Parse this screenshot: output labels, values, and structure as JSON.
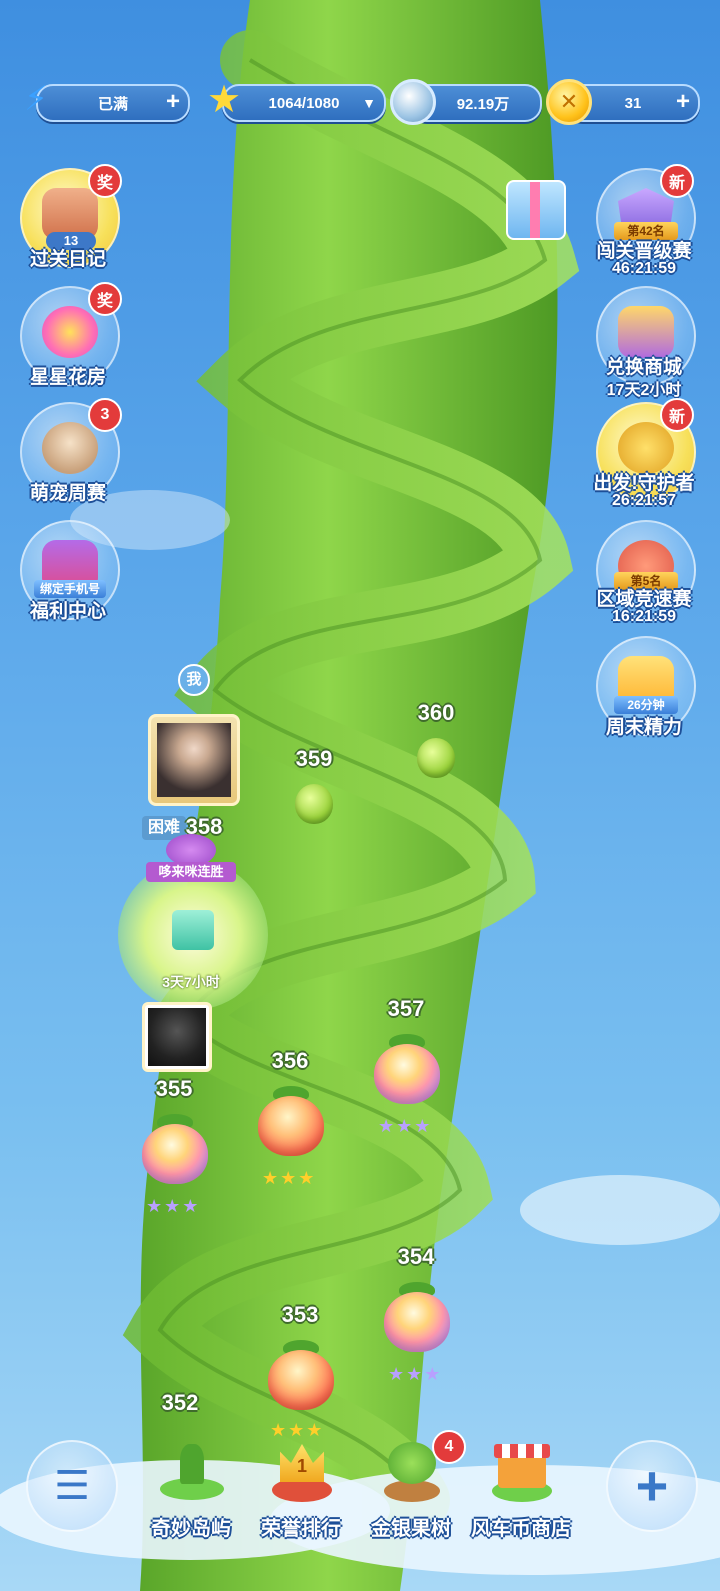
{
  "topbar": {
    "energy": {
      "value": "已满",
      "icon": "lightning-icon"
    },
    "stars": {
      "value": "1064/1080",
      "icon": "star-icon"
    },
    "silver": {
      "value": "92.19万",
      "icon": "silver-coin-icon"
    },
    "gold": {
      "value": "31",
      "icon": "gold-coin-icon"
    }
  },
  "left_menu": [
    {
      "label": "过关日记",
      "badge": "奖",
      "count": "13"
    },
    {
      "label": "星星花房",
      "badge": "奖"
    },
    {
      "label": "萌宠周赛",
      "badge": "3"
    },
    {
      "label": "福利中心",
      "tag": "绑定手机号"
    }
  ],
  "right_menu": [
    {
      "label": "闯关晋级赛",
      "badge": "新",
      "tag": "第42名",
      "timer": "46:21:59"
    },
    {
      "label": "兑换商城",
      "timer": "17天2小时"
    },
    {
      "label": "出发!守护者",
      "badge": "新",
      "timer": "26:21:57"
    },
    {
      "label": "区域竞速赛",
      "tag": "第5名",
      "timer": "16:21:59"
    },
    {
      "label": "周末精力",
      "tag": "26分钟"
    }
  ],
  "player": {
    "me_label": "我",
    "difficulty": "困难",
    "current_level": "358",
    "streak_label": "哆来咪连胜",
    "streak_timer": "3天7小时"
  },
  "levels": [
    {
      "num": "360",
      "state": "locked"
    },
    {
      "num": "359",
      "state": "locked"
    },
    {
      "num": "357",
      "stars": 3
    },
    {
      "num": "356",
      "stars": 3
    },
    {
      "num": "355",
      "stars": 3
    },
    {
      "num": "354",
      "stars": 3
    },
    {
      "num": "353",
      "stars": 3
    },
    {
      "num": "352",
      "stars": 3
    }
  ],
  "bottom_nav": [
    {
      "label": "奇妙岛屿",
      "icon": "island-icon"
    },
    {
      "label": "荣誉排行",
      "icon": "crown-icon",
      "rank": "1"
    },
    {
      "label": "金银果树",
      "icon": "fruit-tree-icon",
      "badge": "4"
    },
    {
      "label": "风车币商店",
      "icon": "shop-icon"
    }
  ],
  "colors": {
    "accent_red": "#e33b3b",
    "vine_green": "#7cc83a",
    "sky_blue": "#5aa6ea"
  }
}
